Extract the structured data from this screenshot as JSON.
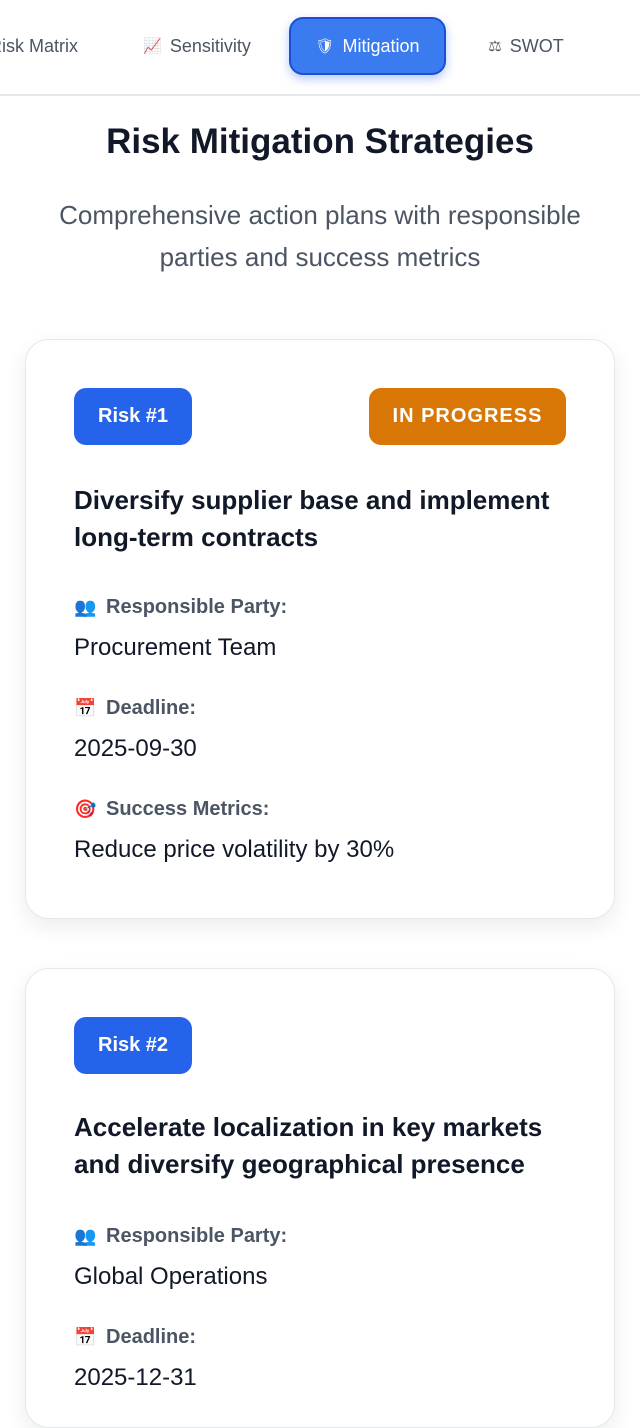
{
  "tabs": [
    {
      "label": "Risk Matrix",
      "icon": "grid-icon",
      "glyph": "▦"
    },
    {
      "label": "Sensitivity",
      "icon": "chart-increasing-icon",
      "glyph": "📈"
    },
    {
      "label": "Mitigation",
      "icon": "shield-icon",
      "glyph": "🛡"
    },
    {
      "label": "SWOT",
      "icon": "balance-scale-icon",
      "glyph": "⚖"
    }
  ],
  "active_tab": "Mitigation",
  "header": {
    "title": "Risk Mitigation Strategies",
    "subtitle": "Comprehensive action plans with responsible parties and success metrics"
  },
  "field_labels": {
    "responsible_party": "Responsible Party:",
    "deadline": "Deadline:",
    "success_metrics": "Success Metrics:"
  },
  "field_icons": {
    "responsible_party": "👥",
    "deadline": "📅",
    "success_metrics": "🎯"
  },
  "strategies": [
    {
      "risk_label": "Risk #1",
      "status": "IN PROGRESS",
      "status_color": "#d97706",
      "title": "Diversify supplier base and implement long-term contracts",
      "responsible_party": "Procurement Team",
      "deadline": "2025-09-30",
      "success_metrics": "Reduce price volatility by 30%"
    },
    {
      "risk_label": "Risk #2",
      "title": "Accelerate localization in key markets and diversify geographical presence",
      "responsible_party": "Global Operations",
      "deadline": "2025-12-31"
    }
  ],
  "colors": {
    "accent": "#2563eb",
    "active_tab": "#3b7bf0",
    "in_progress": "#d97706"
  }
}
